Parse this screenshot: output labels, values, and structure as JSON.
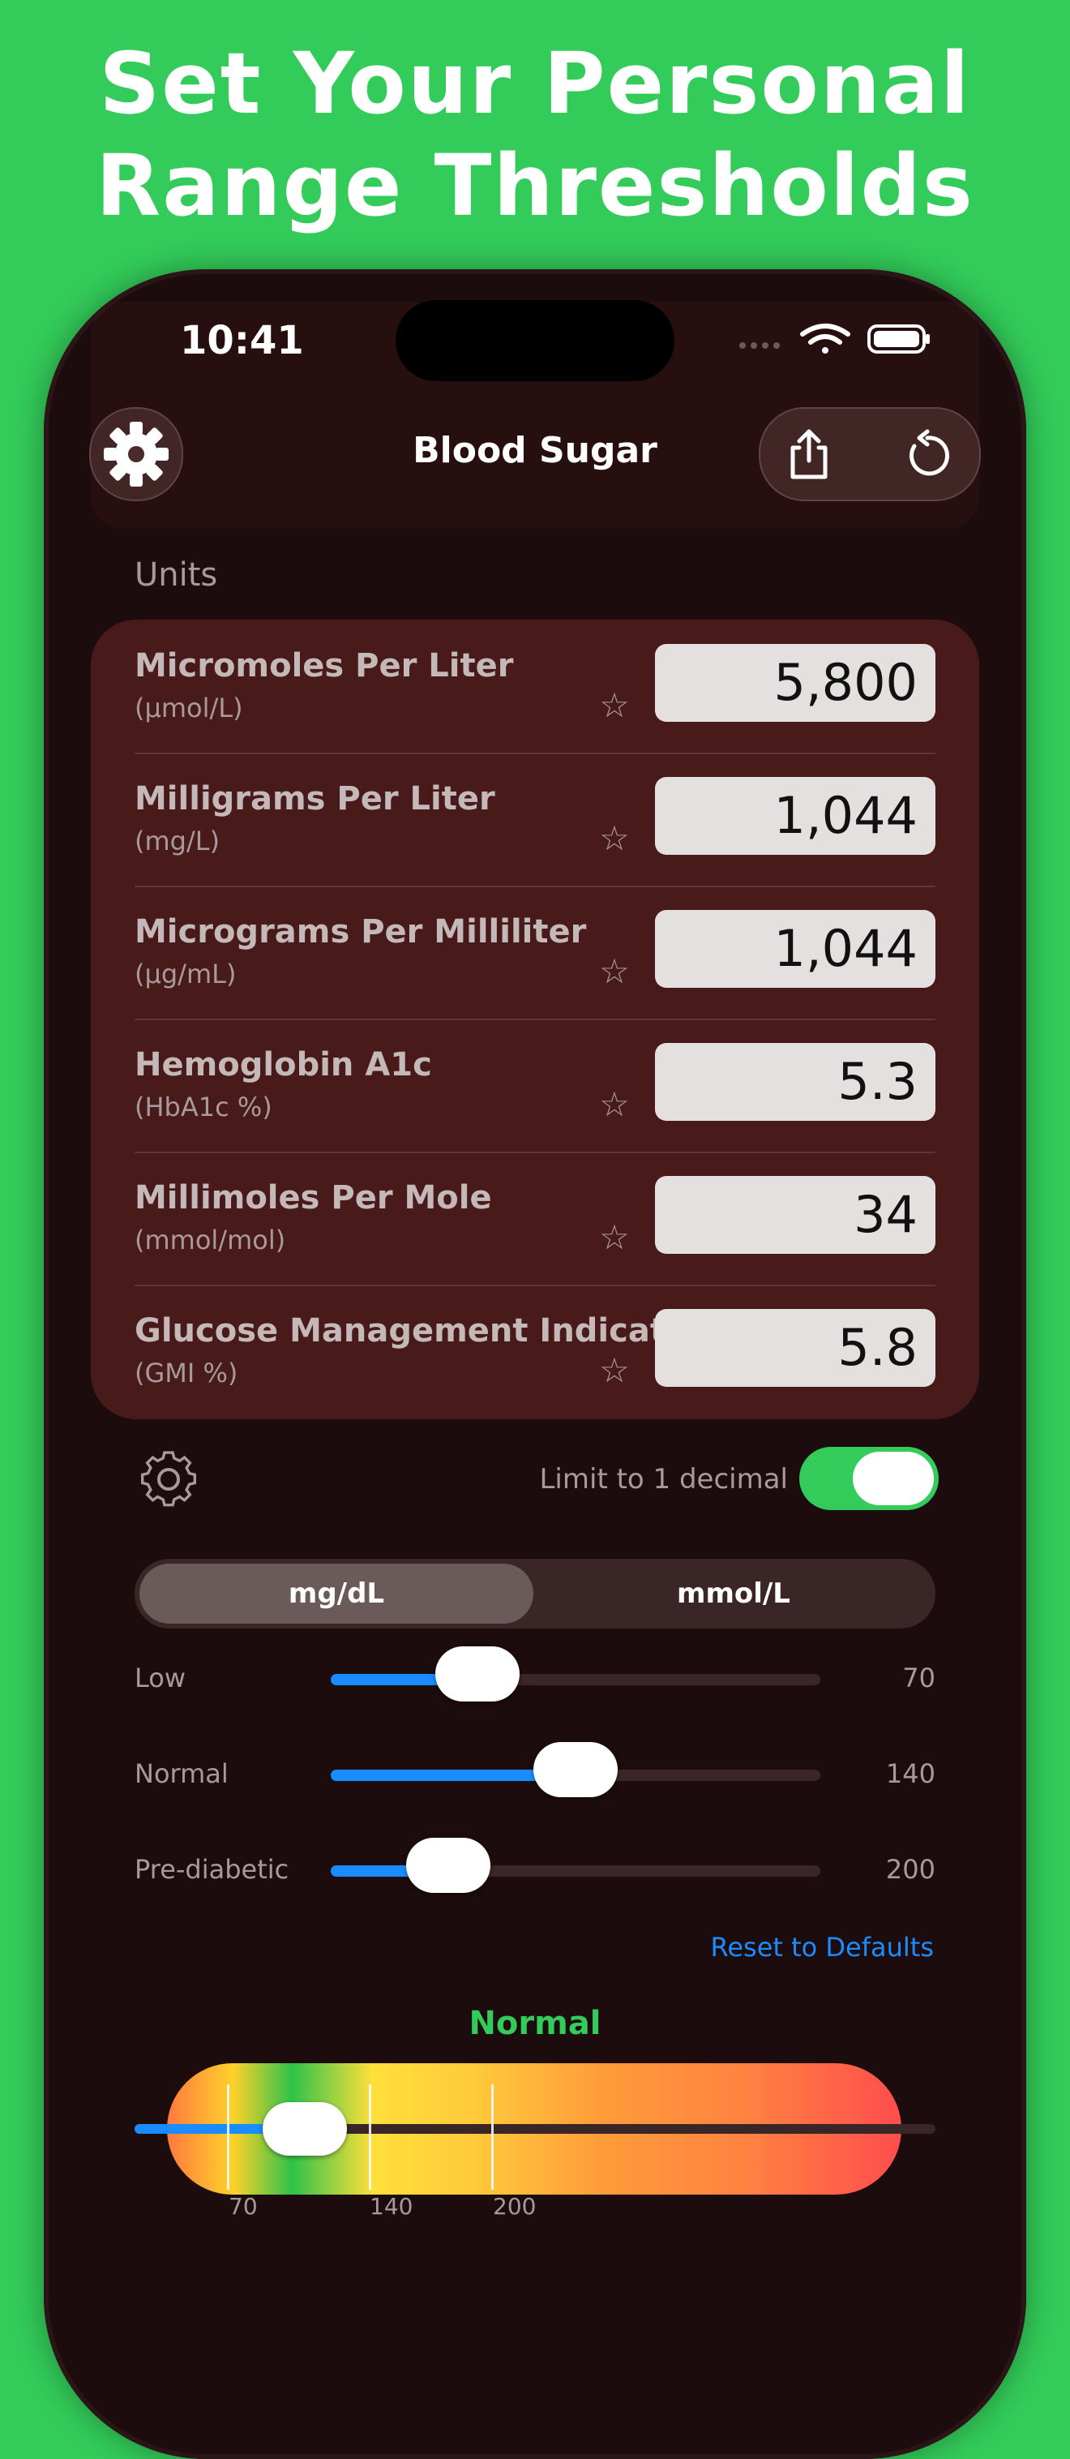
{
  "headline": {
    "line1": "Set Your Personal",
    "line2": "Range Thresholds"
  },
  "status_bar": {
    "time": "10:41"
  },
  "nav": {
    "title": "Blood Sugar"
  },
  "units_section": {
    "label": "Units"
  },
  "units": [
    {
      "name": "Micromoles Per Liter",
      "abbr": "(µmol/L)",
      "value": "5,800",
      "favorite": false
    },
    {
      "name": "Milligrams Per Liter",
      "abbr": "(mg/L)",
      "value": "1,044",
      "favorite": false
    },
    {
      "name": "Micrograms Per Milliliter",
      "abbr": "(µg/mL)",
      "value": "1,044",
      "favorite": false
    },
    {
      "name": "Hemoglobin A1c",
      "abbr": "(HbA1c %)",
      "value": "5.3",
      "favorite": false
    },
    {
      "name": "Millimoles Per Mole",
      "abbr": "(mmol/mol)",
      "value": "34",
      "favorite": false
    },
    {
      "name": "Glucose Management Indicator",
      "abbr": "(GMI %)",
      "value": "5.8",
      "favorite": false
    }
  ],
  "decimal_toggle": {
    "label": "Limit to 1 decimal",
    "on": true
  },
  "unit_segment": {
    "options": [
      "mg/dL",
      "mmol/L"
    ],
    "selected": "mg/dL"
  },
  "thresholds": [
    {
      "label": "Low",
      "value": "70",
      "position": 0.3
    },
    {
      "label": "Normal",
      "value": "140",
      "position": 0.5
    },
    {
      "label": "Pre-diabetic",
      "value": "200",
      "position": 0.24
    }
  ],
  "reset_label": "Reset to Defaults",
  "range_status": {
    "text": "Normal",
    "color": "#33cc5a"
  },
  "gauge": {
    "tick_labels": [
      "70",
      "140",
      "200"
    ]
  },
  "colors": {
    "accent_blue": "#1a8cff",
    "toggle_green": "#33cc5a",
    "background": "#33cc5a"
  },
  "icons": [
    "gear-icon",
    "share-icon",
    "reset-icon",
    "star-icon",
    "wifi-icon",
    "battery-icon",
    "settings-gear-icon"
  ]
}
